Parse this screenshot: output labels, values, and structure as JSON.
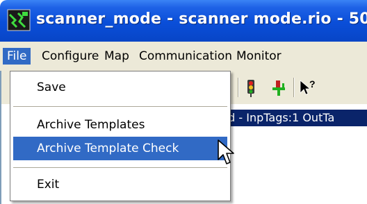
{
  "window": {
    "title": "scanner_mode - scanner mode.rio - 50"
  },
  "menubar": {
    "items": [
      {
        "label": "File",
        "active": true
      },
      {
        "label": "Configure"
      },
      {
        "label": "Map"
      },
      {
        "label": "Communication"
      },
      {
        "label": "Monitor"
      }
    ]
  },
  "file_menu": {
    "items": [
      {
        "label": "Save"
      },
      {
        "label": "Archive Templates"
      },
      {
        "label": "Archive Template Check",
        "highlighted": true
      },
      {
        "label": "Exit"
      }
    ]
  },
  "tree": {
    "selected_row_text": "ud - InpTags:1 OutTa"
  },
  "toolbar": {
    "icons": [
      "traffic-light-icon",
      "plug-green-icon",
      "help-pointer-icon"
    ]
  },
  "colors": {
    "titlebar": "#0a4ed8",
    "menubar": "#ece9d8",
    "highlight": "#316ac5",
    "selected_row": "#0a246a"
  }
}
